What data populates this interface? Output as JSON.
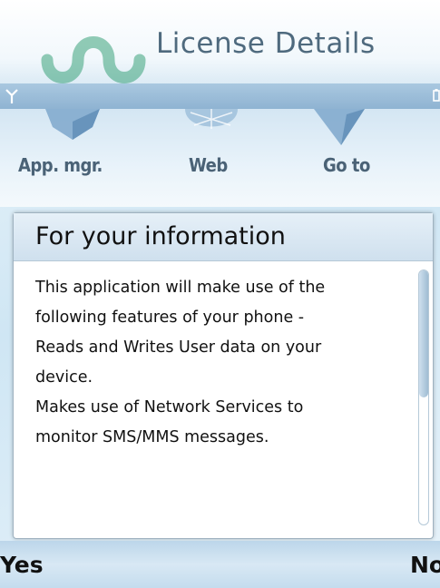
{
  "header": {
    "title": "License Details",
    "logo_icon": "umu-logo-icon"
  },
  "status": {
    "signal_icon": "signal-antenna-icon",
    "battery_icon": "battery-icon"
  },
  "toolbar": {
    "items": [
      {
        "label": "App. mgr.",
        "icon": "app-manager-icon"
      },
      {
        "label": "Web",
        "icon": "web-globe-icon"
      },
      {
        "label": "Go to",
        "icon": "goto-icon"
      }
    ]
  },
  "dialog": {
    "title": "For your information",
    "lines": [
      "This application will make use of the",
      "following features of your phone -",
      "Reads and Writes User data on your",
      "device.",
      "Makes use of Network Services to",
      "monitor SMS/MMS messages."
    ]
  },
  "softkeys": {
    "left": "Yes",
    "right": "No"
  },
  "colors": {
    "accent": "#8fb3d2",
    "logo_green": "#3aa37a",
    "title_text": "#4f6a7e"
  }
}
